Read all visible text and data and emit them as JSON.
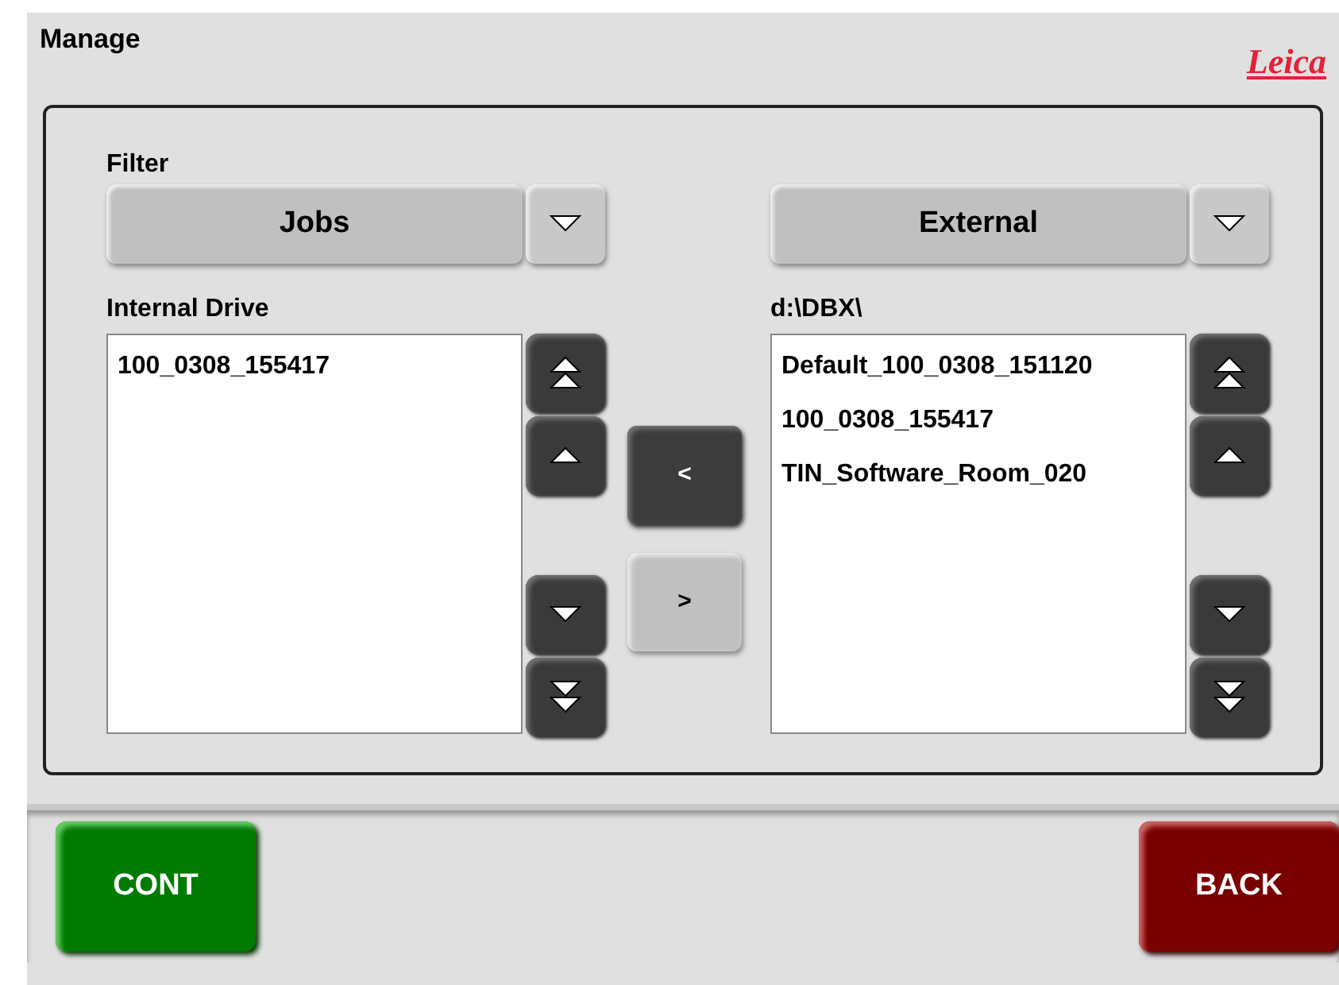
{
  "title": "Manage",
  "logo": "Leica",
  "filter_label": "Filter",
  "left": {
    "dropdown": "Jobs",
    "list_label": "Internal Drive",
    "items": [
      "100_0308_155417"
    ]
  },
  "right": {
    "dropdown": "External",
    "list_label": "d:\\DBX\\",
    "items": [
      "Default_100_0308_151120",
      "100_0308_155417",
      "TIN_Software_Room_020"
    ]
  },
  "transfer_buttons": [
    {
      "label": "<",
      "disabled": false
    },
    {
      "label": ">",
      "disabled": true
    }
  ],
  "footer_buttons": [
    {
      "label": "CONT",
      "kind": "continue"
    },
    {
      "label": "BACK",
      "kind": "back"
    }
  ]
}
